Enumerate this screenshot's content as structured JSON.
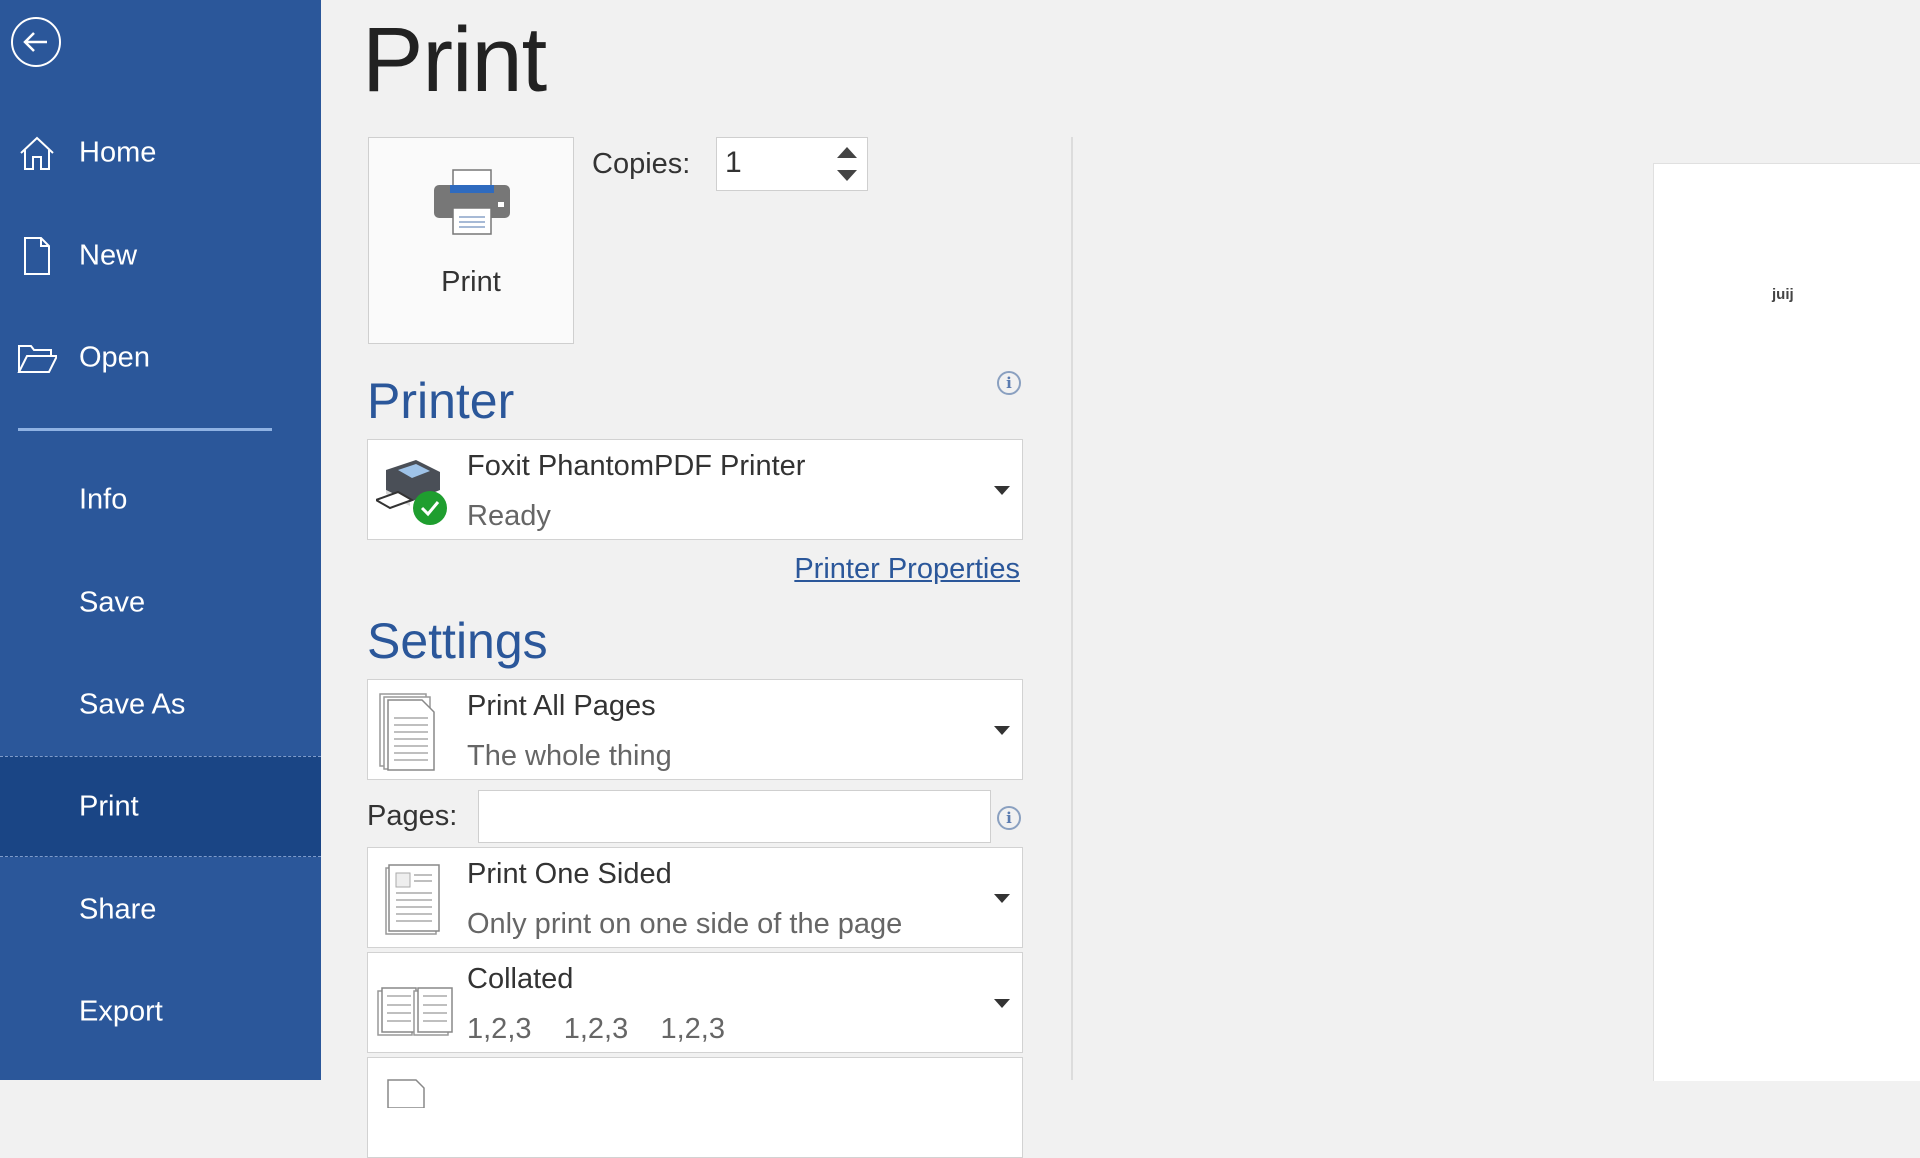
{
  "sidebar": {
    "back_label": "Back",
    "items": [
      {
        "label": "Home",
        "icon": "home-icon"
      },
      {
        "label": "New",
        "icon": "new-document-icon"
      },
      {
        "label": "Open",
        "icon": "open-folder-icon"
      },
      {
        "label": "Info"
      },
      {
        "label": "Save"
      },
      {
        "label": "Save As"
      },
      {
        "label": "Print",
        "selected": true
      },
      {
        "label": "Share"
      },
      {
        "label": "Export"
      }
    ]
  },
  "main": {
    "title": "Print",
    "print_button_label": "Print",
    "copies_label": "Copies:",
    "copies_value": "1",
    "printer_heading": "Printer",
    "printer": {
      "name": "Foxit PhantomPDF Printer",
      "status": "Ready"
    },
    "printer_properties_link": "Printer Properties",
    "settings_heading": "Settings",
    "settings": [
      {
        "title": "Print All Pages",
        "subtitle": "The whole thing"
      },
      {
        "title": "Print One Sided",
        "subtitle": "Only print on one side of the page"
      },
      {
        "title": "Collated",
        "subtitle": "1,2,3    1,2,3    1,2,3"
      }
    ],
    "pages_label": "Pages:",
    "pages_value": ""
  },
  "preview": {
    "text": "juij"
  },
  "colors": {
    "sidebar": "#2b579a",
    "sidebar_selected": "#1a4585",
    "accent": "#2b579a",
    "ready_green": "#1f9e2f"
  }
}
